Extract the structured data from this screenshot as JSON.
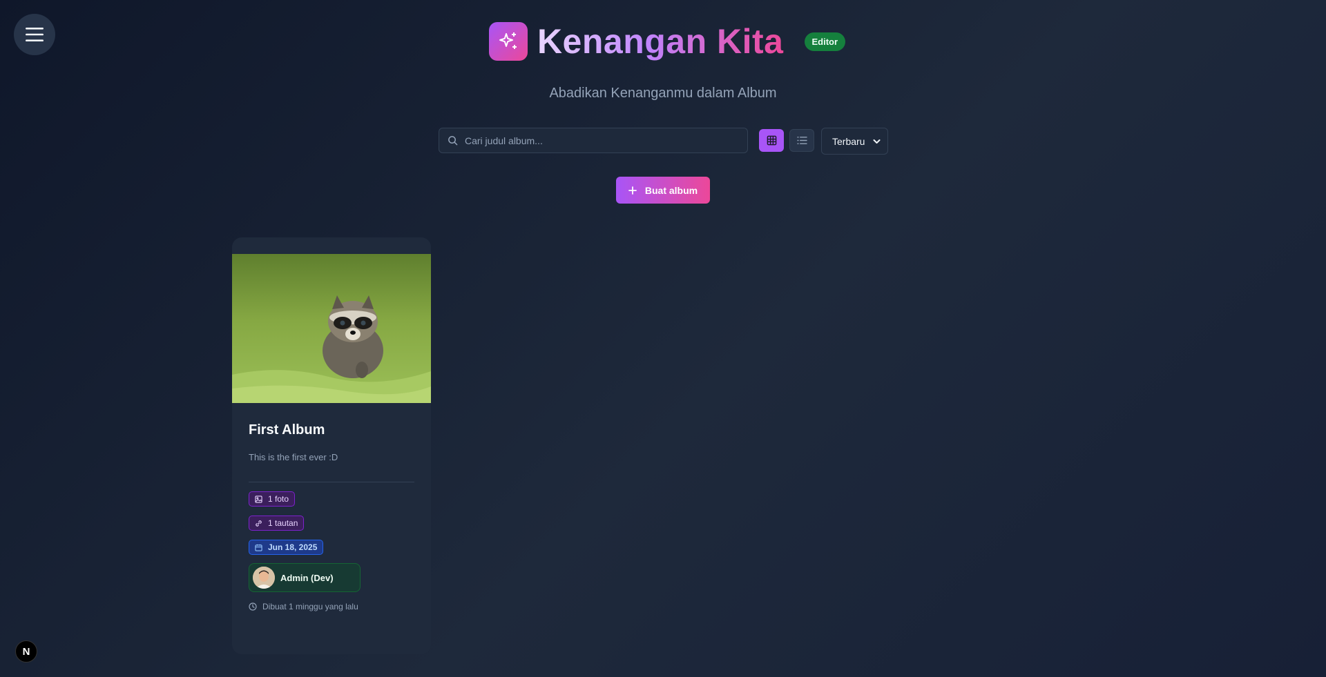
{
  "header": {
    "title": "Kenangan Kita",
    "role_badge": "Editor",
    "subtitle": "Abadikan Kenanganmu dalam Album"
  },
  "search": {
    "placeholder": "Cari judul album...",
    "value": ""
  },
  "sort": {
    "selected": "Terbaru"
  },
  "view": {
    "active": "grid"
  },
  "actions": {
    "create_album": "Buat album"
  },
  "albums": [
    {
      "title": "First Album",
      "description": "This is the first ever :D",
      "photo_count": "1 foto",
      "link_count": "1 tautan",
      "date": "Jun 18, 2025",
      "owner": "Admin (Dev)",
      "created": "Dibuat 1 minggu yang lalu"
    }
  ],
  "dev_badge": "N",
  "colors": {
    "accent_start": "#a855f7",
    "accent_end": "#ec4899",
    "editor_badge": "#15803d"
  }
}
